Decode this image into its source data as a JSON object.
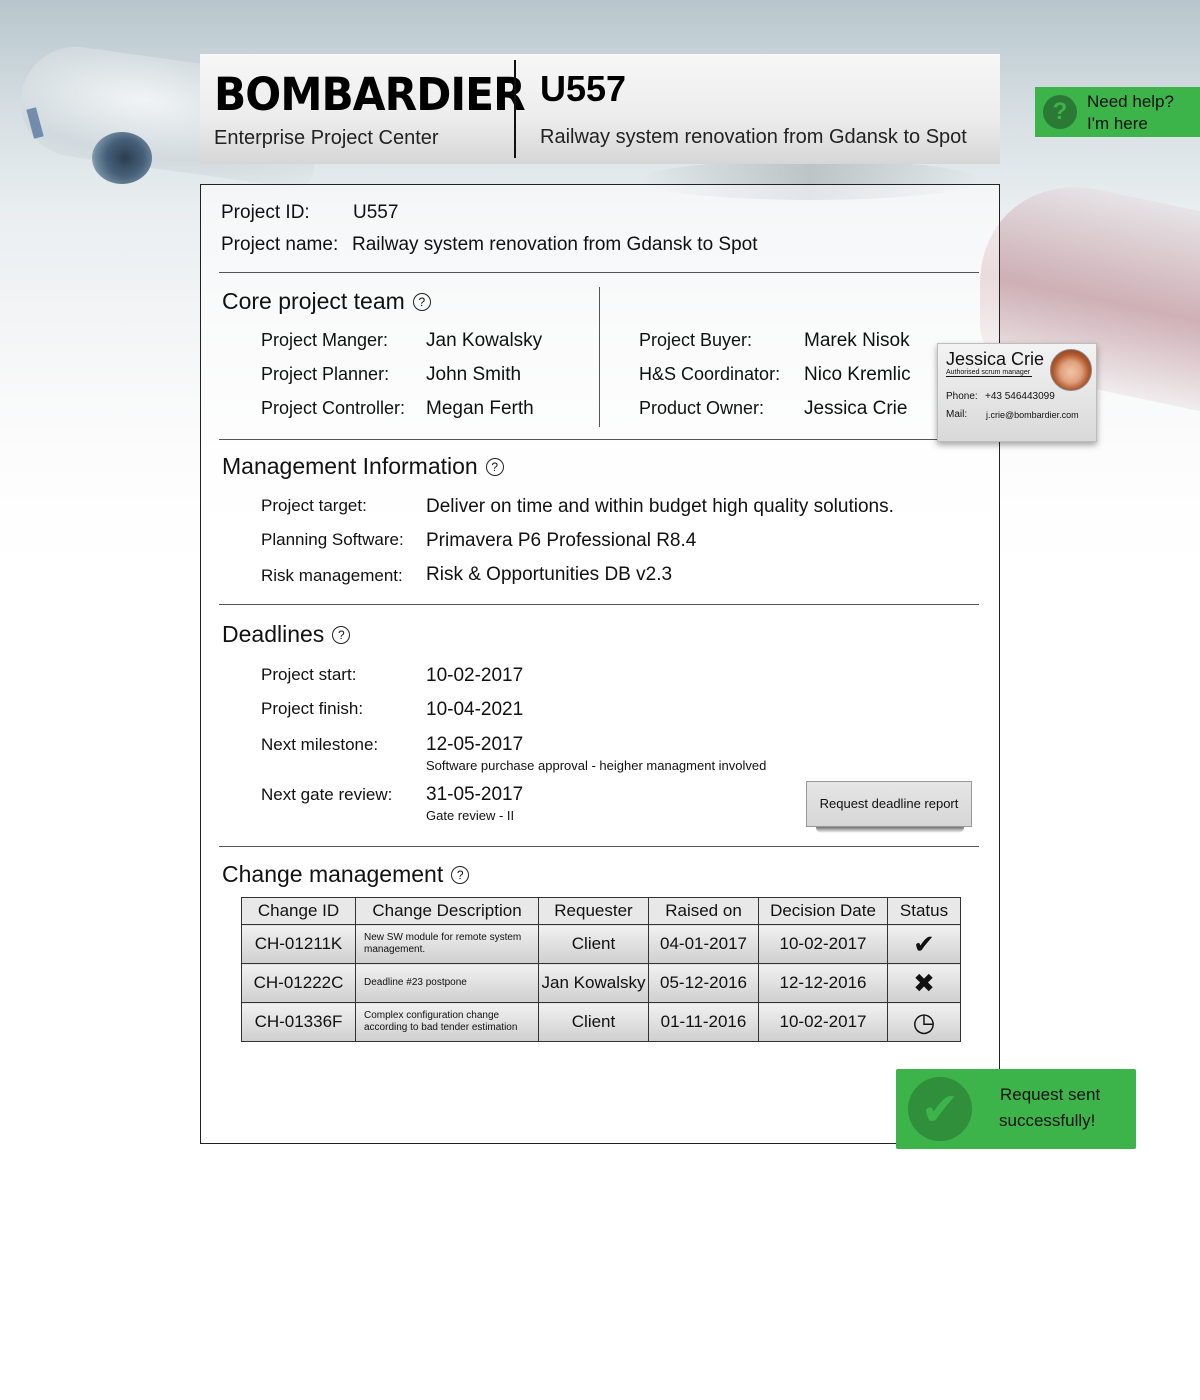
{
  "header": {
    "brand": "BOMBARDIER",
    "subtitle": "Enterprise Project Center",
    "project_code": "U557",
    "project_title": "Railway system renovation from Gdansk to Spot"
  },
  "help": {
    "line1": "Need help?",
    "line2": "I'm here",
    "icon": "?"
  },
  "project": {
    "id_label": "Project ID:",
    "id_value": "U557",
    "name_label": "Project name:",
    "name_value": "Railway system renovation from Gdansk to Spot"
  },
  "core_team": {
    "title": "Core project team",
    "left": [
      {
        "label": "Project Manger:",
        "value": "Jan Kowalsky"
      },
      {
        "label": "Project Planner:",
        "value": "John Smith"
      },
      {
        "label": "Project Controller:",
        "value": "Megan Ferth"
      }
    ],
    "right": [
      {
        "label": "Project Buyer:",
        "value": "Marek Nisok"
      },
      {
        "label": "H&S Coordinator:",
        "value": "Nico Kremlic"
      },
      {
        "label": "Product Owner:",
        "value": "Jessica Crie"
      }
    ]
  },
  "contact_card": {
    "name": "Jessica Crie",
    "role": "Authorised scrum manager",
    "phone_label": "Phone:",
    "phone": "+43 546443099",
    "mail_label": "Mail:",
    "mail": "j.crie@bombardier.com"
  },
  "management": {
    "title": "Management Information",
    "rows": [
      {
        "label": "Project target:",
        "value": "Deliver on time and within budget high quality solutions."
      },
      {
        "label": "Planning Software:",
        "value": "Primavera P6 Professional R8.4"
      },
      {
        "label": "Risk management:",
        "value": "Risk & Opportunities DB v2.3"
      }
    ]
  },
  "deadlines": {
    "title": "Deadlines",
    "start_label": "Project start:",
    "start": "10-02-2017",
    "finish_label": "Project finish:",
    "finish": "10-04-2021",
    "milestone_label": "Next milestone:",
    "milestone": "12-05-2017",
    "milestone_note": "Software purchase approval - heigher managment involved",
    "gate_label": "Next gate review:",
    "gate": "31-05-2017",
    "gate_note": "Gate review - II",
    "button": "Request deadline report"
  },
  "change_mgmt": {
    "title": "Change management",
    "columns": [
      "Change ID",
      "Change Description",
      "Requester",
      "Raised on",
      "Decision Date",
      "Status"
    ],
    "rows": [
      {
        "id": "CH-01211K",
        "desc": "New SW module for remote system  management.",
        "requester": "Client",
        "raised": "04-01-2017",
        "decision": "10-02-2017",
        "status_icon": "check-icon",
        "status_glyph": "✔"
      },
      {
        "id": "CH-01222C",
        "desc": "Deadline #23 postpone",
        "requester": "Jan Kowalsky",
        "raised": "05-12-2016",
        "decision": "12-12-2016",
        "status_icon": "cross-icon",
        "status_glyph": "✖"
      },
      {
        "id": "CH-01336F",
        "desc": "Complex configuration change according to bad tender estimation",
        "requester": "Client",
        "raised": "01-11-2016",
        "decision": "10-02-2017",
        "status_icon": "clock-icon",
        "status_glyph": "◷"
      }
    ]
  },
  "toast": {
    "line1": "Request sent",
    "line2": "successfully!",
    "icon": "✔"
  },
  "colors": {
    "accent_green": "#3cb44a",
    "dark_green": "#2a7a35"
  }
}
